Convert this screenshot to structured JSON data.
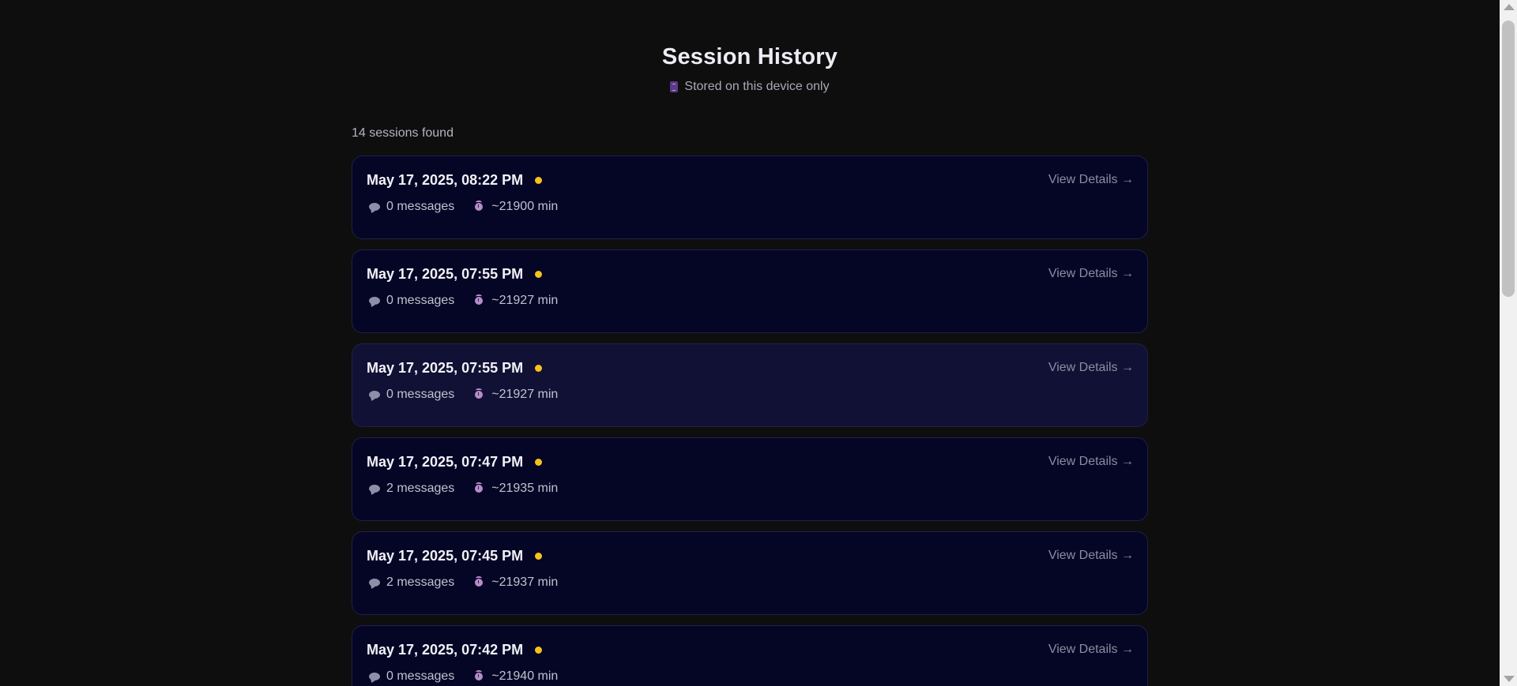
{
  "header": {
    "title": "Session History",
    "subtitle": "Stored on this device only",
    "subtitle_icon": "device-icon"
  },
  "list": {
    "count_label": "14 sessions found",
    "view_details_label": "View Details →",
    "status_color": "#f4c21b",
    "sessions": [
      {
        "date": "May 17, 2025, 08:22 PM",
        "messages": "0 messages",
        "duration": "~21900 min"
      },
      {
        "date": "May 17, 2025, 07:55 PM",
        "messages": "0 messages",
        "duration": "~21927 min"
      },
      {
        "date": "May 17, 2025, 07:55 PM",
        "messages": "0 messages",
        "duration": "~21927 min"
      },
      {
        "date": "May 17, 2025, 07:47 PM",
        "messages": "2 messages",
        "duration": "~21935 min"
      },
      {
        "date": "May 17, 2025, 07:45 PM",
        "messages": "2 messages",
        "duration": "~21937 min"
      },
      {
        "date": "May 17, 2025, 07:42 PM",
        "messages": "0 messages",
        "duration": "~21940 min"
      }
    ]
  }
}
